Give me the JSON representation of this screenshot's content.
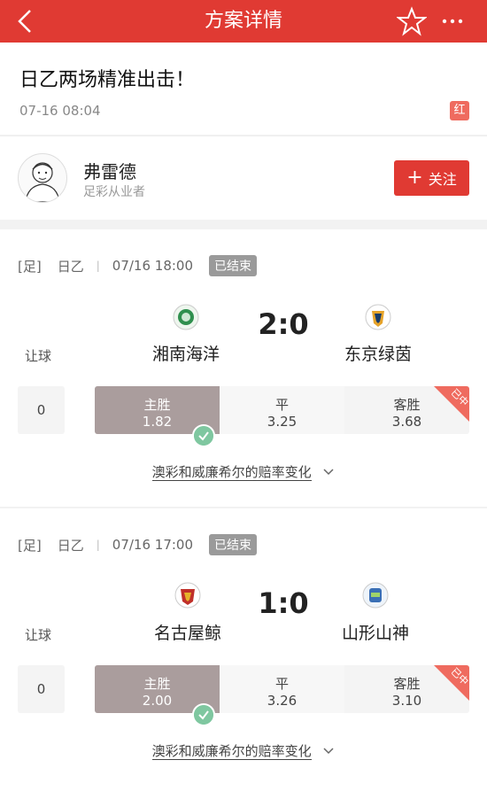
{
  "nav": {
    "title": "方案详情"
  },
  "plan": {
    "title": "日乙两场精准出击！",
    "time": "07-16 08:04",
    "badge": "红"
  },
  "author": {
    "name": "弗雷德",
    "role": "足彩从业者",
    "follow_label": "关注"
  },
  "handicap_label": "让球",
  "odds_change_label": "澳彩和威廉希尔的赔率变化",
  "matches": [
    {
      "type": "[足]",
      "league": "日乙",
      "time": "07/16 18:00",
      "status": "已结束",
      "home": "湘南海洋",
      "away": "东京绿茵",
      "score": "2:0",
      "handicap": "0",
      "odds": [
        {
          "label": "主胜",
          "value": "1.82",
          "selected": true
        },
        {
          "label": "平",
          "value": "3.25",
          "selected": false
        },
        {
          "label": "客胜",
          "value": "3.68",
          "selected": false
        }
      ],
      "corner_text": "已中"
    },
    {
      "type": "[足]",
      "league": "日乙",
      "time": "07/16 17:00",
      "status": "已结束",
      "home": "名古屋鲸",
      "away": "山形山神",
      "score": "1:0",
      "handicap": "0",
      "odds": [
        {
          "label": "主胜",
          "value": "2.00",
          "selected": true
        },
        {
          "label": "平",
          "value": "3.26",
          "selected": false
        },
        {
          "label": "客胜",
          "value": "3.10",
          "selected": false
        }
      ],
      "corner_text": "已中"
    }
  ],
  "colors": {
    "brand": "#e03a33",
    "win": "#aa9d9d",
    "check": "#7fc7a0"
  }
}
